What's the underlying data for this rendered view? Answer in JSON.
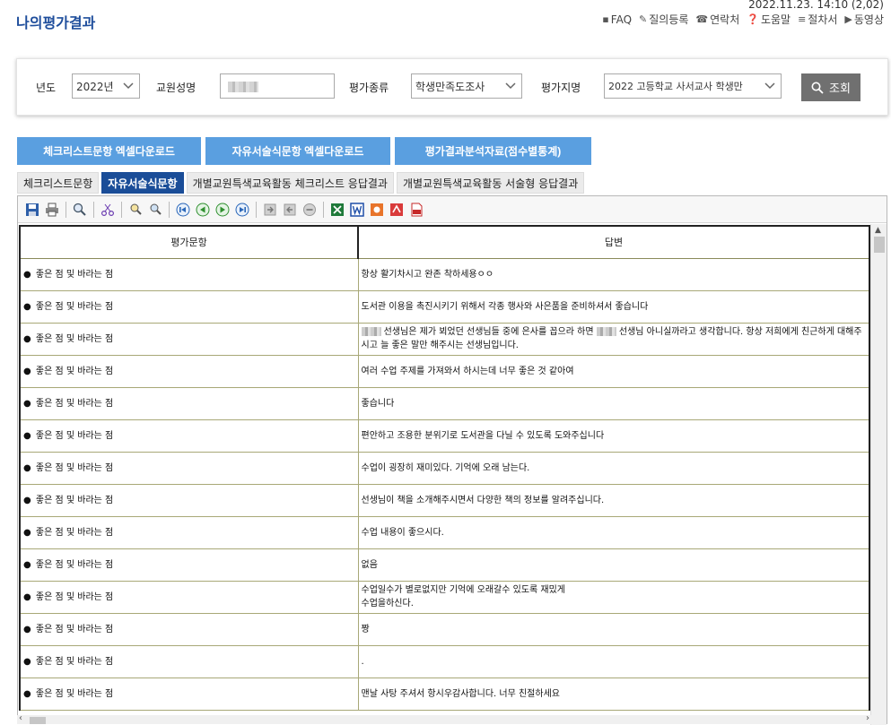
{
  "header": {
    "title": "나의평가결과",
    "datetime": "2022.11.23. 14:10 (2,02)",
    "links": [
      {
        "icon": "faq-icon",
        "label": "FAQ"
      },
      {
        "icon": "pencil-icon",
        "label": "질의등록"
      },
      {
        "icon": "phone-icon",
        "label": "연락처"
      },
      {
        "icon": "help-icon",
        "label": "도움말"
      },
      {
        "icon": "list-icon",
        "label": "절차서"
      },
      {
        "icon": "play-icon",
        "label": "동영상"
      }
    ]
  },
  "search": {
    "year_label": "년도",
    "year_value": "2022년",
    "teacher_label": "교원성명",
    "teacher_value": "",
    "eval_type_label": "평가종류",
    "eval_type_value": "학생만족도조사",
    "eval_paper_label": "평가지명",
    "eval_paper_value": "2022 고등학교 사서교사 학생만",
    "search_button": "조회"
  },
  "downloads": [
    "체크리스트문항 엑셀다운로드",
    "자유서술식문항 엑셀다운로드",
    "평가결과분석자료(점수별통계)"
  ],
  "tabs": [
    {
      "label": "체크리스트문항",
      "active": false
    },
    {
      "label": "자유서술식문항",
      "active": true
    },
    {
      "label": "개별교원특색교육활동 체크리스트 응답결과",
      "active": false
    },
    {
      "label": "개별교원특색교육활동 서술형 응답결과",
      "active": false
    }
  ],
  "toolbar_icons": [
    "save-icon",
    "print-icon",
    "zoom-icon",
    "cut-icon",
    "find-icon",
    "find-next-icon",
    "first-page-icon",
    "prev-page-icon",
    "next-page-icon",
    "last-page-icon",
    "export-icon",
    "import-icon",
    "stop-icon",
    "excel-icon",
    "word-icon",
    "ppt-icon",
    "hwp-icon",
    "pdf-icon"
  ],
  "table": {
    "headers": [
      "평가문항",
      "답변"
    ],
    "bullet": "●",
    "rows": [
      {
        "q": "좋은 점 및 바라는 점",
        "a": "항상 활기차시고 완존 착하세용ㅇㅇ"
      },
      {
        "q": "좋은 점 및 바라는 점",
        "a": "도서관 이용을 촉진시키기 위해서 각종 행사와 사은품을 준비하셔서 좋습니다"
      },
      {
        "q": "좋은 점 및 바라는 점",
        "a_pre": "",
        "a": " 선생님은 제가 뵈었던 선생님들 중에 은사를 꼽으라 하면 ",
        "a_post": " 선생님 아니실까라고  생각합니다. 항상 저희에게 친근하게 대해주시고 늘 좋은 말만 해주시는 선생님입니다.",
        "redacted": true
      },
      {
        "q": "좋은 점 및 바라는 점",
        "a": "여러 수업 주제를 가져와서 하시는데 너무 좋은 것 같아여"
      },
      {
        "q": "좋은 점 및 바라는 점",
        "a": "좋습니다"
      },
      {
        "q": "좋은 점 및 바라는 점",
        "a": "편안하고 조용한 분위기로 도서관을 다닐 수 있도록 도와주십니다"
      },
      {
        "q": "좋은 점 및 바라는 점",
        "a": "수업이 굉장히 재미있다. 기억에 오래 남는다."
      },
      {
        "q": "좋은 점 및 바라는 점",
        "a": "선생님이 책을 소개해주시면서 다양한 책의 정보를 알려주십니다."
      },
      {
        "q": "좋은 점 및 바라는 점",
        "a": "수업 내용이 좋으시다."
      },
      {
        "q": "좋은 점 및 바라는 점",
        "a": "없음"
      },
      {
        "q": "좋은 점 및 바라는 점",
        "a": "수업일수가 별로없지만 기억에 오래갈수 있도록 재밌게\n수업을하신다."
      },
      {
        "q": "좋은 점 및 바라는 점",
        "a": "짱"
      },
      {
        "q": "좋은 점 및 바라는 점",
        "a": "."
      },
      {
        "q": "좋은 점 및 바라는 점",
        "a": "맨날 사탕 주셔서 항시우감사합니다. 너무 친절하세요"
      }
    ]
  }
}
